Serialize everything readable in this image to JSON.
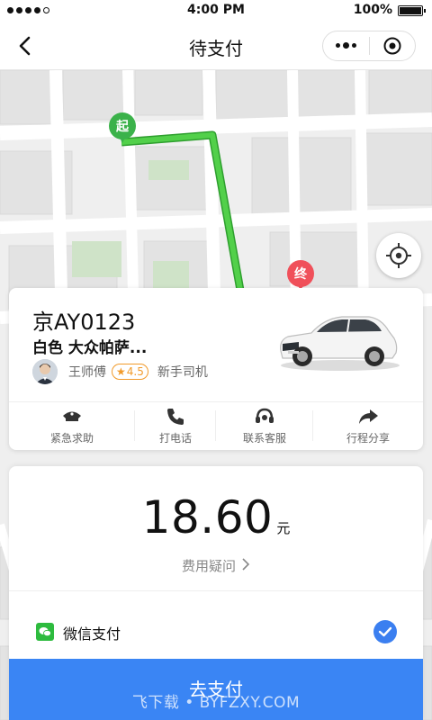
{
  "status_bar": {
    "carrier": "",
    "time": "4:00 PM",
    "battery": "100%",
    "battery_level": 1.0
  },
  "nav": {
    "title": "待支付",
    "back_icon": "chevron-left-icon",
    "more_icon": "more-dots-icon",
    "close_icon": "target-circle-icon"
  },
  "map": {
    "start_label": "起",
    "end_label": "终",
    "route_color": "#3ec43e",
    "start_color": "#3bb24a",
    "end_color": "#f0505a"
  },
  "driver": {
    "plate": "京AY0123",
    "car_model": "白色 大众帕萨...",
    "name": "王师傅",
    "rating": "4.5",
    "tag": "新手司机"
  },
  "actions": [
    {
      "label": "紧急求助",
      "icon": "police-hat-icon"
    },
    {
      "label": "打电话",
      "icon": "phone-icon"
    },
    {
      "label": "联系客服",
      "icon": "headset-icon"
    },
    {
      "label": "行程分享",
      "icon": "share-arrow-icon"
    }
  ],
  "payment": {
    "amount": "18.60",
    "unit": "元",
    "fee_question": "费用疑问",
    "method": "微信支付",
    "method_selected": true,
    "pay_button": "去支付",
    "accent": "#3a85f4"
  },
  "watermark": "飞下载 • BYFZXY.COM"
}
